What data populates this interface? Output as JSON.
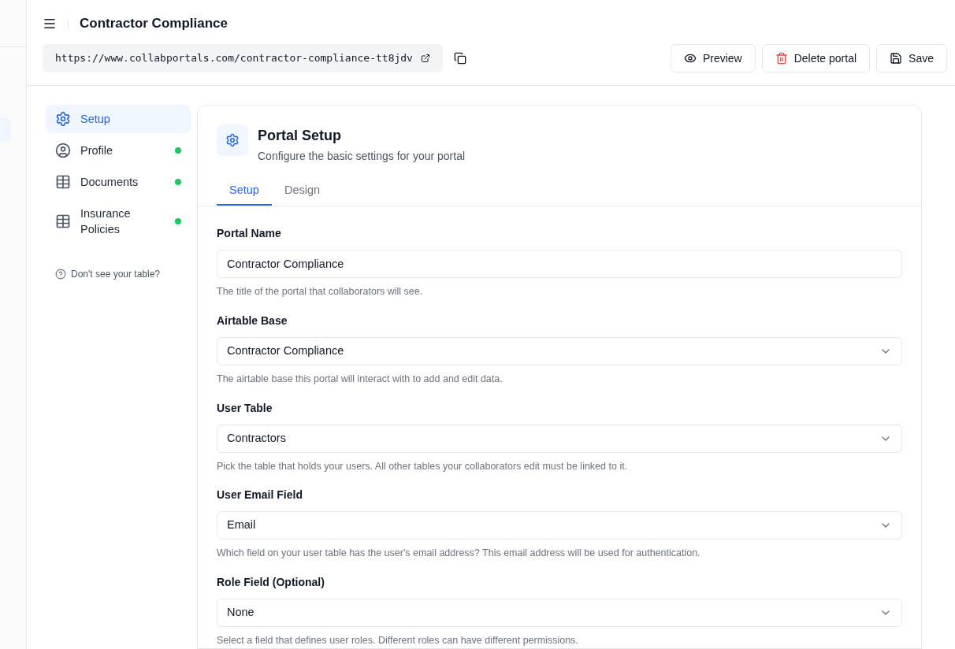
{
  "header": {
    "title": "Contractor Compliance",
    "url": "https://www.collabportals.com/contractor-compliance-tt8jdv",
    "buttons": [
      {
        "kind": "preview",
        "label": "Preview"
      },
      {
        "kind": "delete",
        "label": "Delete portal"
      },
      {
        "kind": "save",
        "label": "Save"
      }
    ]
  },
  "nav": {
    "items": [
      {
        "kind": "gear",
        "label": "Setup",
        "selected": true,
        "complete": false
      },
      {
        "kind": "user",
        "label": "Profile",
        "selected": false,
        "complete": true
      },
      {
        "kind": "table",
        "label": "Documents",
        "selected": false,
        "complete": true
      },
      {
        "kind": "table",
        "label": "Insurance Policies",
        "selected": false,
        "complete": true
      }
    ],
    "help": "Don't see your table?"
  },
  "card": {
    "title": "Portal Setup",
    "subtitle": "Configure the basic settings for your portal",
    "tabs": [
      {
        "label": "Setup",
        "selected": true
      },
      {
        "label": "Design",
        "selected": false
      }
    ],
    "fields": [
      {
        "kind": "text",
        "label": "Portal Name",
        "value": "Contractor Compliance",
        "help": "The title of the portal that collaborators will see."
      },
      {
        "kind": "select",
        "label": "Airtable Base",
        "value": "Contractor Compliance",
        "help": "The airtable base this portal will interact with to add and edit data."
      },
      {
        "kind": "select",
        "label": "User Table",
        "value": "Contractors",
        "help": "Pick the table that holds your users. All other tables your collaborators edit must be linked to it."
      },
      {
        "kind": "select",
        "label": "User Email Field",
        "value": "Email",
        "help": "Which field on your user table has the user's email address? This email address will be used for authentication."
      },
      {
        "kind": "select",
        "label": "Role Field (Optional)",
        "value": "None",
        "help": "Select a field that defines user roles. Different roles can have different permissions."
      }
    ]
  }
}
